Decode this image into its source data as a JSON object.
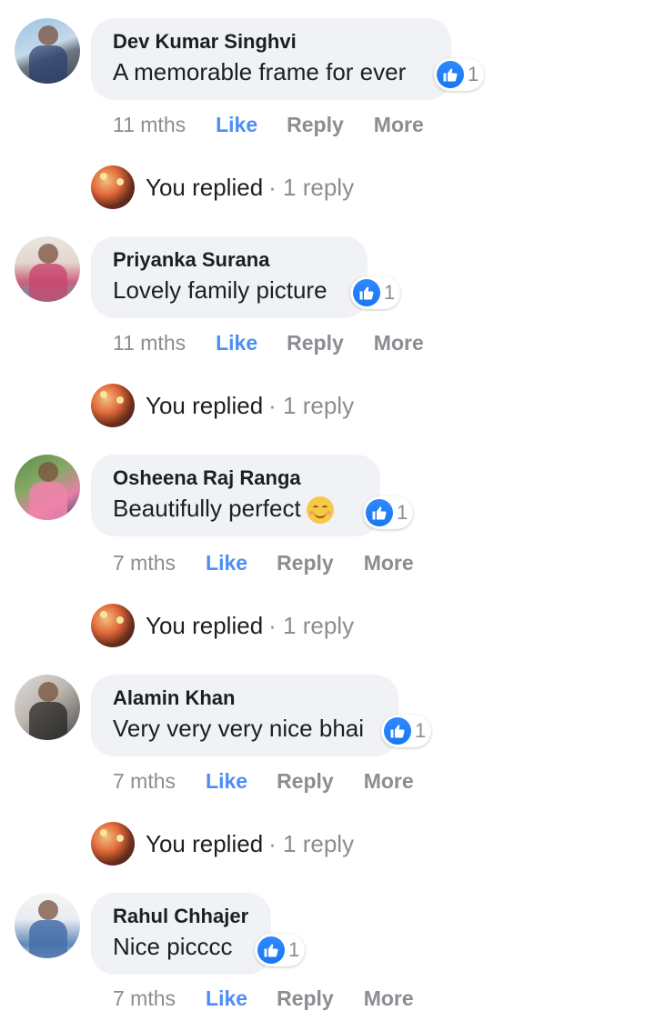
{
  "icons": {
    "like": "like-thumb-icon",
    "emoji": "smiling-face-emoji-icon"
  },
  "colors": {
    "like_blue": "#1877f2",
    "like_link": "#4b8ef7",
    "bubble_bg": "#f0f2f5",
    "meta_gray": "#8a8d91"
  },
  "actions": {
    "like": "Like",
    "reply": "Reply",
    "more": "More"
  },
  "comments": [
    {
      "author": "Dev Kumar Singhvi",
      "text": "A memorable frame for ever",
      "reactions": "1",
      "time": "11 mths",
      "replied": "You replied",
      "reply_count": "· 1 reply"
    },
    {
      "author": "Priyanka Surana",
      "text": "Lovely family picture",
      "reactions": "1",
      "time": "11 mths",
      "replied": "You replied",
      "reply_count": "· 1 reply"
    },
    {
      "author": "Osheena Raj Ranga",
      "text": "Beautifully perfect",
      "reactions": "1",
      "time": "7 mths",
      "replied": "You replied",
      "reply_count": "· 1 reply"
    },
    {
      "author": "Alamin Khan",
      "text": "Very very very nice bhai",
      "reactions": "1",
      "time": "7 mths",
      "replied": "You replied",
      "reply_count": "· 1 reply"
    },
    {
      "author": "Rahul Chhajer",
      "text": "Nice picccc",
      "reactions": "1",
      "time": "7 mths"
    }
  ]
}
